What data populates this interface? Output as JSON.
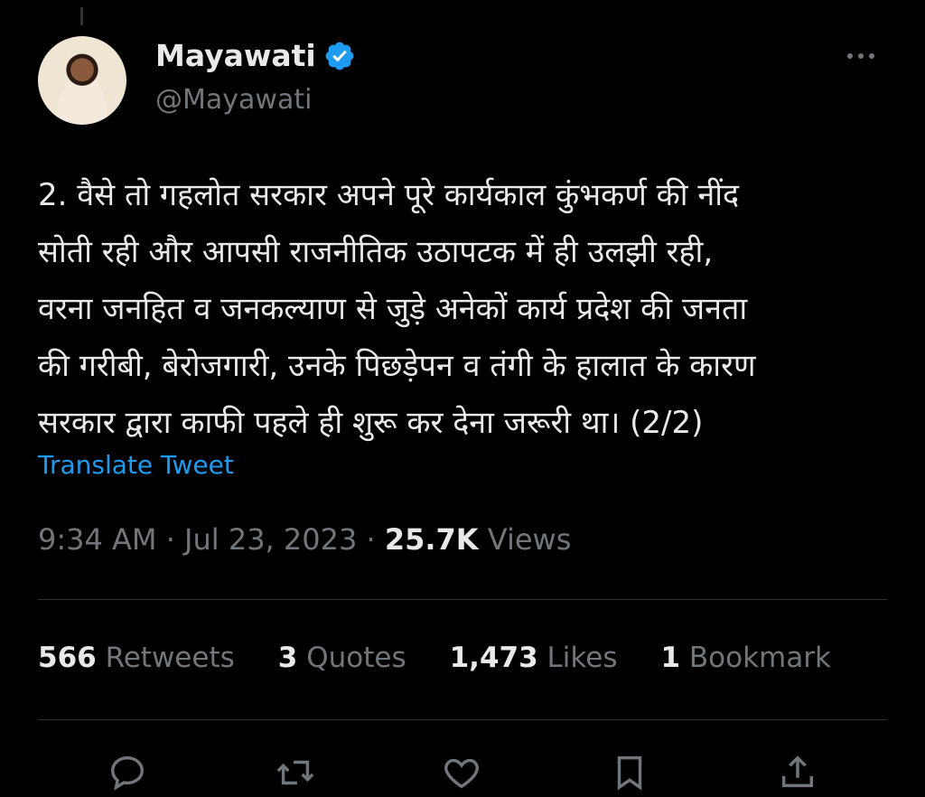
{
  "author": {
    "name": "Mayawati",
    "handle": "@Mayawati",
    "verified": true
  },
  "tweet": {
    "text": "2. वैसे तो गहलोत सरकार अपने पूरे कार्यकाल कुंभकर्ण की नींद\nसोती रही और आपसी राजनीतिक उठापटक में ही उलझी रही,\nवरना जनहित व जनकल्याण से जुड़े अनेकों कार्य प्रदेश की जनता\nकी गरीबी, बेरोजगारी, उनके पिछड़ेपन व तंगी के हालात के कारण\nसरकार द्वारा काफी पहले ही शुरू कर देना जरूरी था। (2/2)",
    "translate_label": "Translate Tweet"
  },
  "meta": {
    "time": "9:34 AM",
    "separator": " · ",
    "date": "Jul 23, 2023",
    "views_count": "25.7K",
    "views_label": " Views"
  },
  "stats": {
    "retweets_count": "566",
    "retweets_label": " Retweets",
    "quotes_count": "3",
    "quotes_label": " Quotes",
    "likes_count": "1,473",
    "likes_label": " Likes",
    "bookmarks_count": "1",
    "bookmarks_label": " Bookmark"
  },
  "icons": {
    "reply": "reply-icon",
    "retweet": "retweet-icon",
    "like": "heart-icon",
    "bookmark": "bookmark-icon",
    "share": "share-icon",
    "more": "more-icon",
    "verified": "verified-icon"
  },
  "colors": {
    "background": "#000000",
    "text": "#e7e9ea",
    "secondary": "#71767b",
    "link": "#1d9bf0",
    "verified": "#1d9bf0"
  }
}
